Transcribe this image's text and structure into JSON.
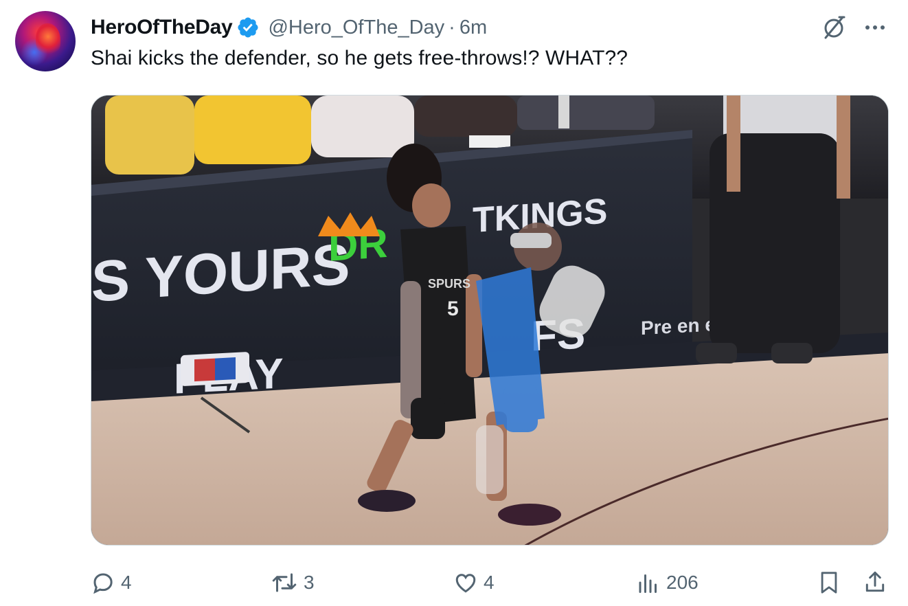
{
  "tweet": {
    "author": {
      "display_name": "HeroOfTheDay",
      "handle": "@Hero_OfThe_Day",
      "verified": true,
      "verified_color": "#1d9bf0",
      "avatar_icon": "avatar"
    },
    "separator": "·",
    "time": "6m",
    "text": "Shai kicks the defender, so he gets free-throws!?  WHAT??",
    "media": {
      "type": "video-frame",
      "signage": {
        "left_board": "S YOURS",
        "sponsor": "DR  TKINGS",
        "floor_board": "PLAY  FS",
        "presented": "Pre  en  ed by",
        "jersey_team": "SPURS",
        "jersey_number": "5"
      }
    },
    "actions": {
      "reply": {
        "icon": "reply-icon",
        "count": "4"
      },
      "retweet": {
        "icon": "retweet-icon",
        "count": "3"
      },
      "like": {
        "icon": "heart-icon",
        "count": "4"
      },
      "views": {
        "icon": "views-icon",
        "count": "206"
      },
      "bookmark": {
        "icon": "bookmark-icon"
      },
      "share": {
        "icon": "share-icon"
      }
    },
    "colors": {
      "text_primary": "#0f1419",
      "text_secondary": "#536471",
      "accent": "#1d9bf0"
    }
  }
}
